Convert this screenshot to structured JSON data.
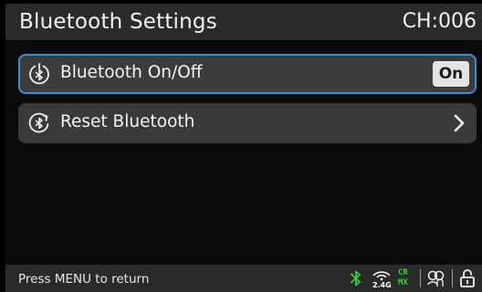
{
  "header": {
    "title": "Bluetooth Settings",
    "channel": "CH:006"
  },
  "menu": {
    "items": [
      {
        "label": "Bluetooth On/Off",
        "value": "On",
        "icon": "bluetooth-power-icon",
        "selected": true
      },
      {
        "label": "Reset Bluetooth",
        "icon": "bluetooth-reset-icon",
        "selected": false
      }
    ]
  },
  "footer": {
    "hint": "Press MENU to return",
    "wireless_band": "2.4G",
    "mode_top": "CR",
    "mode_bottom": "MX",
    "status_icons": [
      "bluetooth-icon",
      "wireless-2-4g-icon",
      "crmx-icon",
      "group-icon",
      "unlock-icon"
    ]
  },
  "colors": {
    "selection_border": "#3b8fd6",
    "status_green": "#3ec93e",
    "toggle_bg": "#e4e4e4"
  }
}
